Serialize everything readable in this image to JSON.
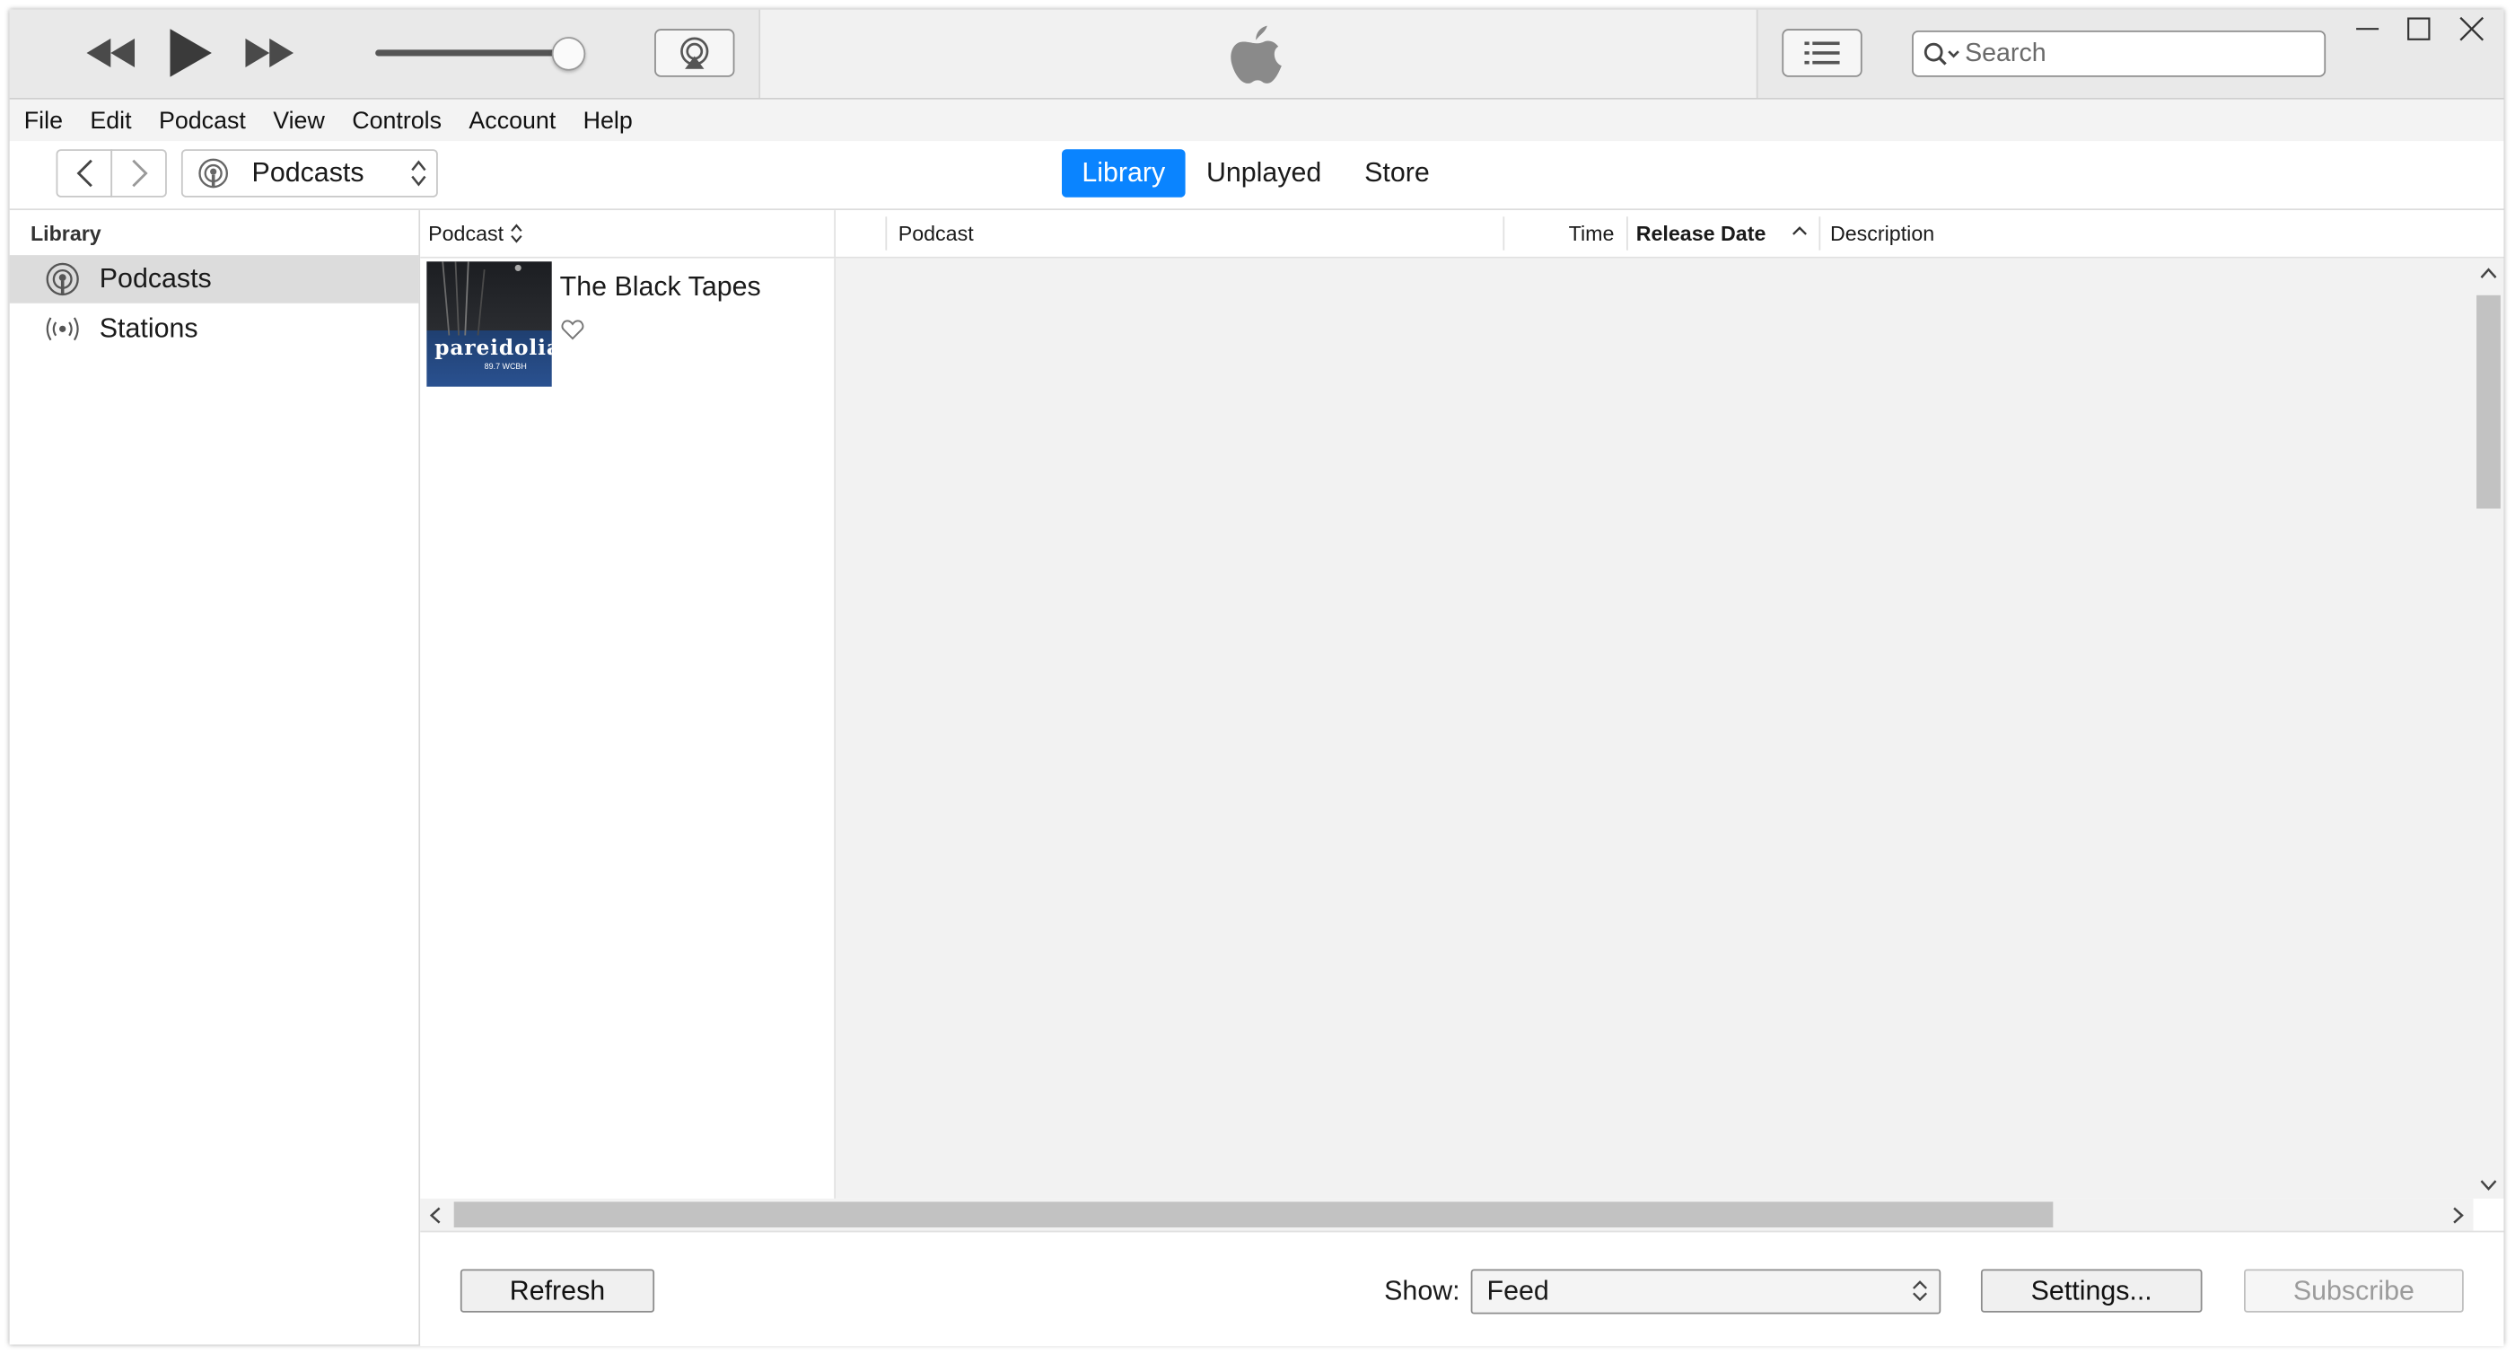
{
  "player": {
    "rewind_icon": "rewind-icon",
    "play_icon": "play-icon",
    "forward_icon": "fast-forward-icon",
    "volume": 0.85,
    "airplay_icon": "airplay-icon",
    "logo_icon": "apple-logo-icon",
    "list_icon": "up-next-list-icon"
  },
  "search": {
    "placeholder": "Search"
  },
  "menu": [
    "File",
    "Edit",
    "Podcast",
    "View",
    "Controls",
    "Account",
    "Help"
  ],
  "nav": {
    "media_kind": "Podcasts",
    "tabs": [
      {
        "label": "Library",
        "active": true
      },
      {
        "label": "Unplayed",
        "active": false
      },
      {
        "label": "Store",
        "active": false
      }
    ]
  },
  "sidebar": {
    "heading": "Library",
    "items": [
      {
        "label": "Podcasts",
        "icon": "podcast-icon",
        "selected": true
      },
      {
        "label": "Stations",
        "icon": "radio-station-icon",
        "selected": false
      }
    ]
  },
  "list_header": {
    "podcast_sort": "Podcast",
    "columns": {
      "podcast": "Podcast",
      "time": "Time",
      "release_date": "Release Date",
      "description": "Description"
    }
  },
  "podcasts": [
    {
      "title": "The Black Tapes",
      "artwork_text": "pareidolia",
      "artwork_subtext": "89.7 WCBH"
    }
  ],
  "bottom": {
    "refresh": "Refresh",
    "show_label": "Show:",
    "show_value": "Feed",
    "settings": "Settings...",
    "subscribe": "Subscribe"
  },
  "colors": {
    "accent": "#0a84ff"
  }
}
